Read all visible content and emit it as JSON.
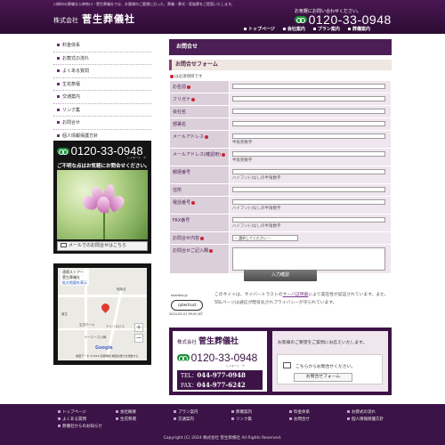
{
  "header": {
    "top_note": "川崎市の葬儀なら神奈川・菅生葬儀社では、お客様のご要望に沿った、葬儀・葬式・家族葬をご提案いたします。",
    "brand_small": "株式会社",
    "brand_name": "菅生葬儀社",
    "contact_note": "お気軽にお問い合わせください。",
    "phone": "0120-33-0948",
    "nav": [
      "トップページ",
      "会社案内",
      "プラン案内",
      "葬儀案内"
    ]
  },
  "sidebar": {
    "nav": [
      "料金体系",
      "お葬式の流れ",
      "よくある質問",
      "生花祭壇",
      "交通案内",
      "リンク集",
      "お問合せ",
      "個人情報保護方針"
    ],
    "contact": {
      "phone": "0120-33-0948",
      "reception": "レイホーシ　ク",
      "lead": "ご不明な点はお気軽にお問合せください。",
      "mail_button": "メールでのお問合せはこちら"
    },
    "map": {
      "place": "菅生葬儀社",
      "label_top": "遠隔ストアー",
      "link": "拡大地図を表示",
      "labels": [
        "稲葉自",
        "菅生",
        "生田ホール",
        "アイリスピエ",
        "ケーエーズ川崎"
      ],
      "google": "Google",
      "footer": "地図データ ©2024 利用規約 地図の誤りを報告する"
    }
  },
  "main": {
    "page_title": "お問合せ",
    "form_title": "お問合せフォーム",
    "required_note": "は必須項目です",
    "fields": [
      {
        "label": "お名前",
        "required": true,
        "note": ""
      },
      {
        "label": "フリガナ",
        "required": true,
        "note": ""
      },
      {
        "label": "会社名",
        "required": false,
        "note": ""
      },
      {
        "label": "部署名",
        "required": false,
        "note": ""
      },
      {
        "label": "メールアドレス",
        "required": true,
        "note": "半角英数字"
      },
      {
        "label": "メールアドレス(確認用)",
        "required": true,
        "note": "半角英数字"
      },
      {
        "label": "郵便番号",
        "required": false,
        "note": "ハイフン(-)なしの半角数字"
      },
      {
        "label": "住所",
        "required": false,
        "note": ""
      },
      {
        "label": "電話番号",
        "required": true,
        "note": "ハイフン(-)なしの半角数字"
      },
      {
        "label": "FAX番号",
        "required": false,
        "note": "ハイフン(-)なしの半角数字"
      }
    ],
    "select_label": "お問合せ内容",
    "select_value": "-- 選択してください --",
    "textarea_label": "お問合せご記入欄",
    "submit_label": "入力確認",
    "ssl_seal_top": "heartbiz.jp",
    "ssl_seal_name": "cybertrust",
    "ssl_seal_bottom": "2024-05-01 09:00 JST",
    "ssl_text_1": "このサイトは、サイバートラストの",
    "ssl_link": "サーバ証明書",
    "ssl_text_2": "により実在性が認証されています。また、SSLページは通信が暗号化されプライバシーが守られています。"
  },
  "banner": {
    "brand_small": "株式会社",
    "brand_name": "菅生葬儀社",
    "phone": "0120-33-0948",
    "reception": "レイホーシ　ク",
    "tel_label": "TEL：",
    "tel": "044-977-0948",
    "fax_label": "FAX：",
    "fax": "044-977-6242",
    "lead": "お客様のご要望をご質問にお応えいたします。",
    "mail_text": "こちらからお問合せください。",
    "mail_button": "お問合せフォーム"
  },
  "footer": {
    "nav": [
      "トップページ",
      "会社概要",
      "プラン案内",
      "葬儀案内",
      "料金体系",
      "お葬式の流れ",
      "よくある質問",
      "生花祭壇",
      "交通案内",
      "リンク集",
      "お問合せ",
      "個人情報保護方針",
      "葬儀社からのお知らせ"
    ],
    "copyright": "Copyright (C) 2024 株式会社 菅生葬儀社 All Rights Reserved."
  }
}
